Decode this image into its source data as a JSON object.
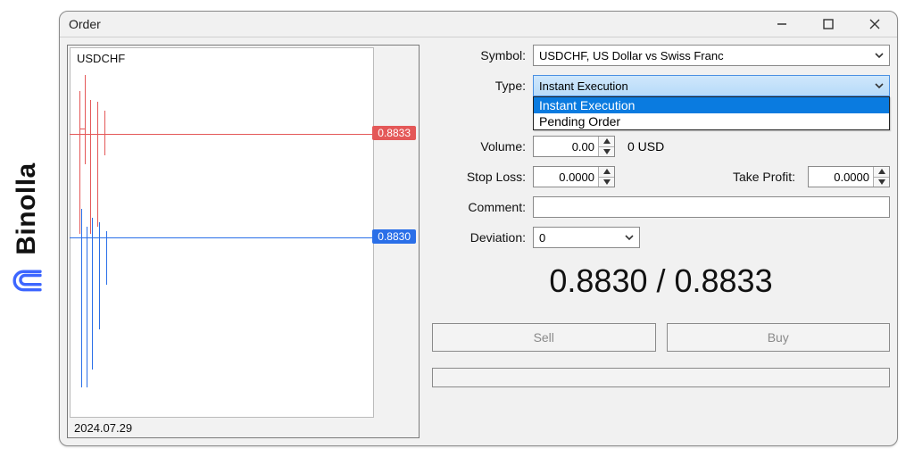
{
  "brand": {
    "name": "Binolla"
  },
  "window": {
    "title": "Order"
  },
  "chart": {
    "symbol": "USDCHF",
    "date": "2024.07.29",
    "ask_price": "0.8833",
    "bid_price": "0.8830"
  },
  "form": {
    "labels": {
      "symbol": "Symbol:",
      "type": "Type:",
      "volume": "Volume:",
      "stop_loss": "Stop Loss:",
      "take_profit": "Take Profit:",
      "comment": "Comment:",
      "deviation": "Deviation:"
    },
    "symbol_value": "USDCHF, US Dollar vs Swiss Franc",
    "type_value": "Instant Execution",
    "type_options": [
      "Instant Execution",
      "Pending Order"
    ],
    "volume_value": "0.00",
    "volume_currency": "0 USD",
    "stop_loss_value": "0.0000",
    "take_profit_value": "0.0000",
    "comment_value": "",
    "deviation_value": "0"
  },
  "prices": {
    "display": "0.8830 / 0.8833"
  },
  "buttons": {
    "sell": "Sell",
    "buy": "Buy"
  },
  "chart_data": {
    "type": "line",
    "series": [
      {
        "name": "ask",
        "price": 0.8833,
        "color": "#e45858"
      },
      {
        "name": "bid",
        "price": 0.883,
        "color": "#2a6fe8"
      }
    ],
    "x_range": [
      "2024.07.29",
      "2024.07.29"
    ],
    "symbol": "USDCHF"
  }
}
